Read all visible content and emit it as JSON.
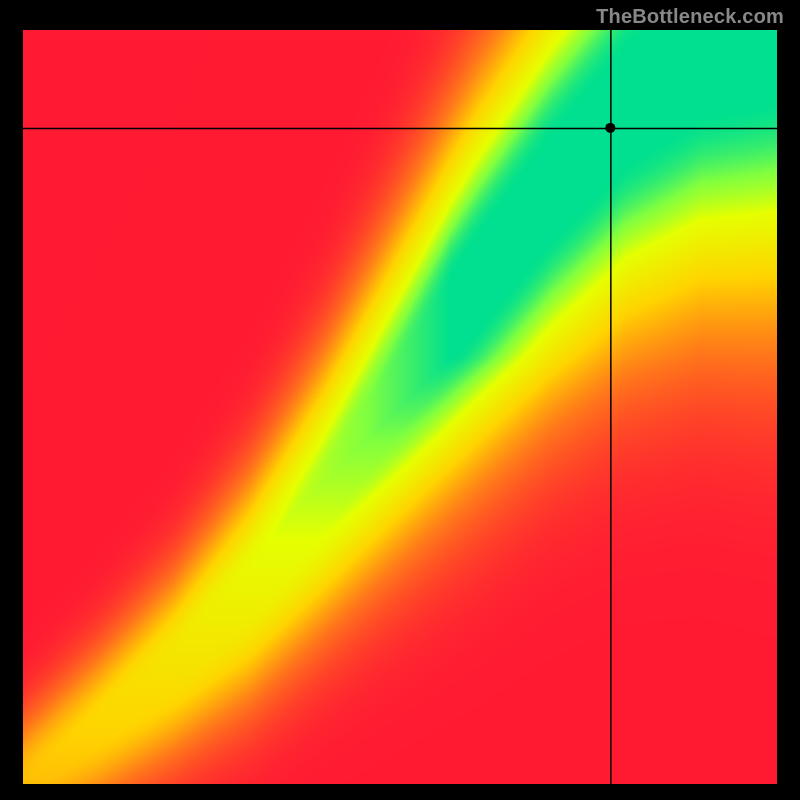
{
  "attribution": "TheBottleneck.com",
  "chart_data": {
    "type": "heatmap",
    "title": "",
    "xlabel": "",
    "ylabel": "",
    "xlim": [
      0,
      100
    ],
    "ylim": [
      0,
      100
    ],
    "grid": false,
    "color_scale": [
      {
        "t": 0.0,
        "color": "#ff1a33"
      },
      {
        "t": 0.3,
        "color": "#ff7a1a"
      },
      {
        "t": 0.55,
        "color": "#ffd400"
      },
      {
        "t": 0.78,
        "color": "#e6ff00"
      },
      {
        "t": 0.9,
        "color": "#80ff40"
      },
      {
        "t": 1.0,
        "color": "#00e090"
      }
    ],
    "ideal_curve": {
      "description": "y where match is optimal for given x; piecewise approximation of the green ridge",
      "points": [
        {
          "x": 0,
          "y": 0
        },
        {
          "x": 10,
          "y": 7
        },
        {
          "x": 20,
          "y": 15
        },
        {
          "x": 30,
          "y": 25
        },
        {
          "x": 40,
          "y": 38
        },
        {
          "x": 50,
          "y": 52
        },
        {
          "x": 60,
          "y": 66
        },
        {
          "x": 70,
          "y": 79
        },
        {
          "x": 80,
          "y": 90
        },
        {
          "x": 90,
          "y": 97
        },
        {
          "x": 100,
          "y": 100
        }
      ]
    },
    "ridge_half_width": {
      "description": "approximate half-width of green band in y units along the curve",
      "values": [
        {
          "x": 0,
          "w": 1.0
        },
        {
          "x": 20,
          "w": 2.0
        },
        {
          "x": 40,
          "w": 3.5
        },
        {
          "x": 60,
          "w": 5.5
        },
        {
          "x": 80,
          "w": 7.0
        },
        {
          "x": 100,
          "w": 8.5
        }
      ]
    },
    "crosshair": {
      "x": 78,
      "y": 87
    },
    "marker": {
      "x": 78,
      "y": 87,
      "radius_px": 5
    }
  }
}
